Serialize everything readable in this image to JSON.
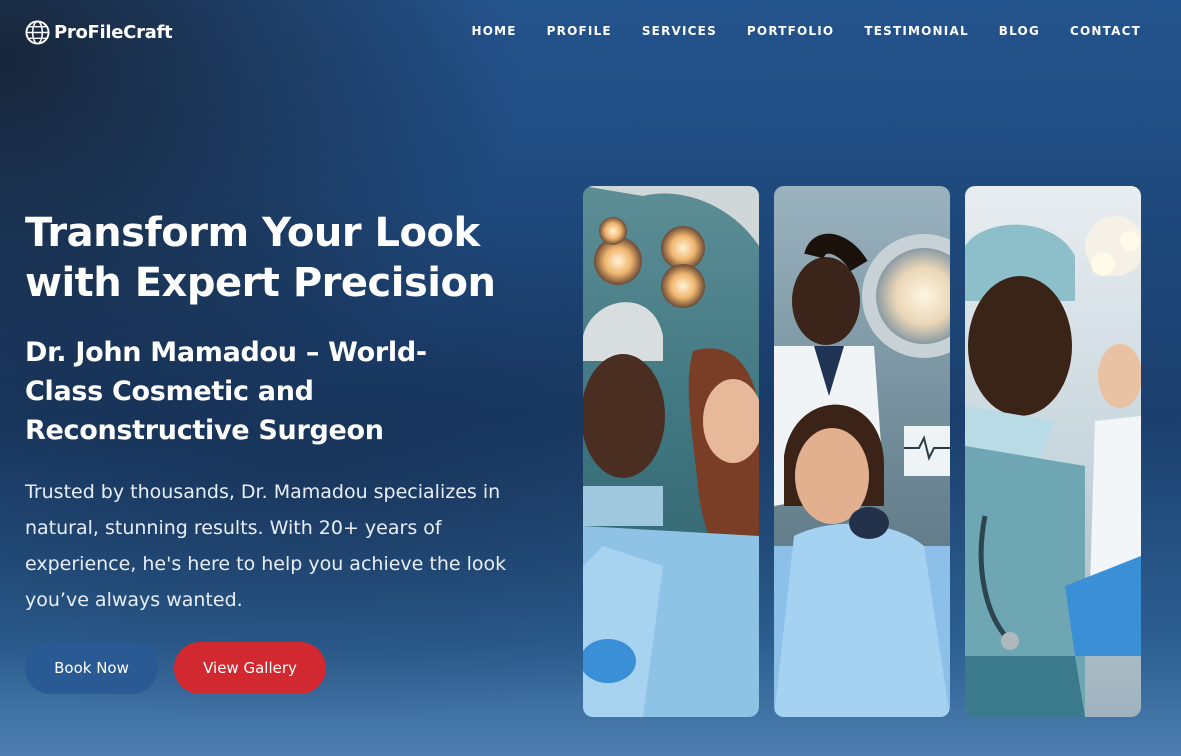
{
  "brand": {
    "name": "ProFileCraft",
    "logo_icon": "globe-icon"
  },
  "nav": {
    "items": [
      "HOME",
      "PROFILE",
      "SERVICES",
      "PORTFOLIO",
      "TESTIMONIAL",
      "BLOG",
      "CONTACT"
    ]
  },
  "hero": {
    "title": "Transform Your Look with Expert Precision",
    "subtitle": "Dr. John Mamadou – World-Class Cosmetic and Reconstructive Surgeon",
    "description": "Trusted by thousands, Dr. Mamadou specializes in natural, stunning results. With 20+ years of experience, he's here to help you achieve the look you’ve always wanted.",
    "book_label": "Book Now",
    "gallery_label": "View Gallery"
  },
  "colors": {
    "book_button": "#2a5a93",
    "gallery_button": "#d1292f",
    "background_top": "#24548d",
    "background_bottom": "#4d7eaf"
  },
  "gallery_images": [
    {
      "name": "surgeon-with-patient-photo-1"
    },
    {
      "name": "surgeon-with-patient-photo-2"
    },
    {
      "name": "surgeon-with-patient-photo-3"
    }
  ]
}
